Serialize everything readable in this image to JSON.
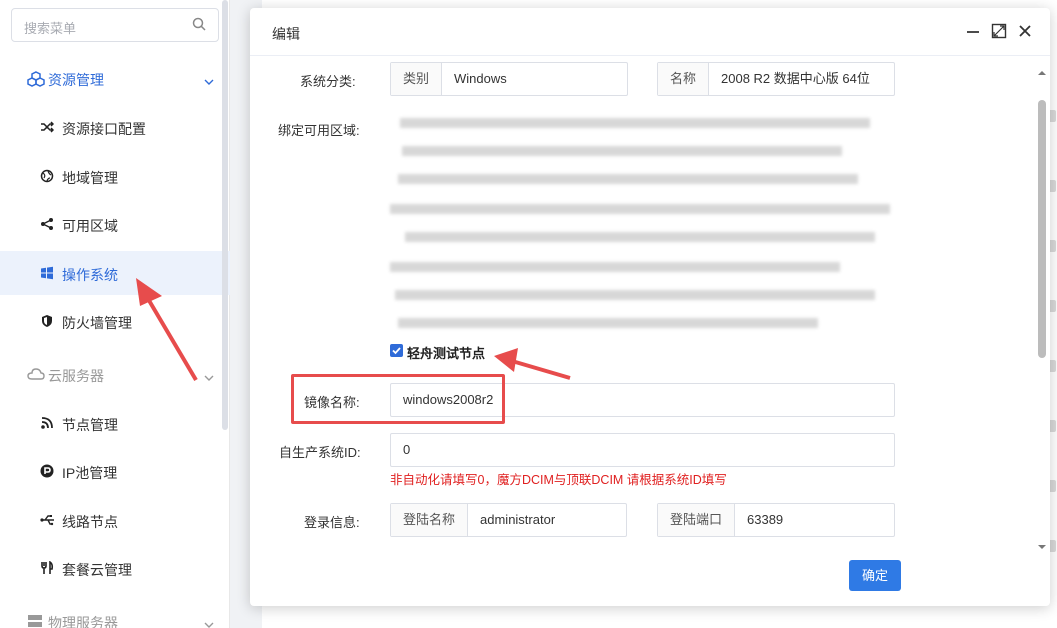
{
  "sidebar": {
    "search_placeholder": "搜索菜单",
    "groups": [
      {
        "label": "资源管理",
        "expanded": true
      },
      {
        "label": "云服务器",
        "expanded": false
      },
      {
        "label": "物理服务器",
        "expanded": false
      }
    ],
    "items": [
      {
        "label": "资源接口配置",
        "icon": "shuffle-icon"
      },
      {
        "label": "地域管理",
        "icon": "globe-icon"
      },
      {
        "label": "可用区域",
        "icon": "share-icon"
      },
      {
        "label": "操作系统",
        "icon": "windows-icon",
        "active": true
      },
      {
        "label": "防火墙管理",
        "icon": "shield-icon"
      },
      {
        "label": "节点管理",
        "icon": "rss-icon"
      },
      {
        "label": "IP池管理",
        "icon": "parking-icon"
      },
      {
        "label": "线路节点",
        "icon": "usb-icon"
      },
      {
        "label": "套餐云管理",
        "icon": "utensils-icon"
      }
    ]
  },
  "dialog": {
    "title": "编辑",
    "fields": {
      "system_category_label": "系统分类:",
      "category_prepend": "类别",
      "category_value": "Windows",
      "name_prepend": "名称",
      "name_value": "2008 R2 数据中心版 64位",
      "bind_zone_label": "绑定可用区域:",
      "checkbox_label": "轻舟测试节点",
      "image_name_label": "镜像名称:",
      "image_name_value": "windows2008r2",
      "self_os_id_label": "自生产系统ID:",
      "self_os_id_value": "0",
      "hint": "非自动化请填写0，魔方DCIM与顶联DCIM 请根据系统ID填写",
      "login_label": "登录信息:",
      "login_name_prepend": "登陆名称",
      "login_name_value": "administrator",
      "login_port_prepend": "登陆端口",
      "login_port_value": "63389"
    },
    "confirm_label": "确定"
  },
  "colors": {
    "accent": "#2f6bd8",
    "annotation_red": "#e74c4c",
    "hint_red": "#e02020",
    "active_bg": "#ecf2fc"
  }
}
